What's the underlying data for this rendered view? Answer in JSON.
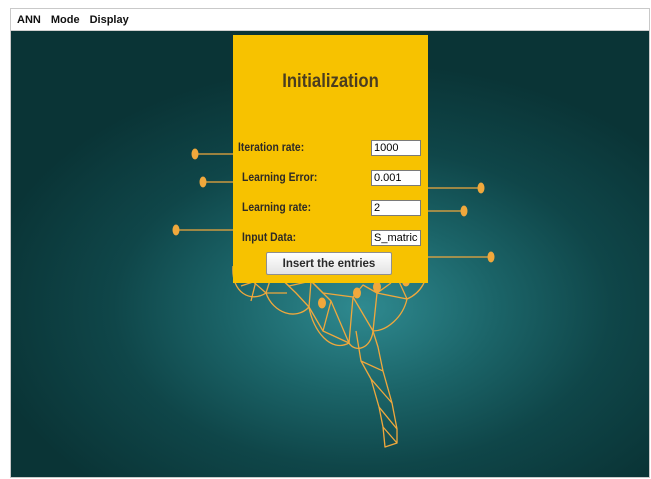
{
  "menubar": {
    "items": [
      {
        "label": "ANN"
      },
      {
        "label": "Mode"
      },
      {
        "label": "Display"
      }
    ]
  },
  "panel": {
    "title": "Initialization",
    "fields": [
      {
        "label": "Iteration rate:",
        "value": "1000"
      },
      {
        "label": "Learning Error:",
        "value": "0.001"
      },
      {
        "label": "Learning rate:",
        "value": "2"
      },
      {
        "label": "Input Data:",
        "value": "S_matrice"
      }
    ],
    "button_label": "Insert the entries"
  },
  "colors": {
    "panel": "#f7c200",
    "background": "#0f4649",
    "brain_lines": "#f0a83c"
  }
}
